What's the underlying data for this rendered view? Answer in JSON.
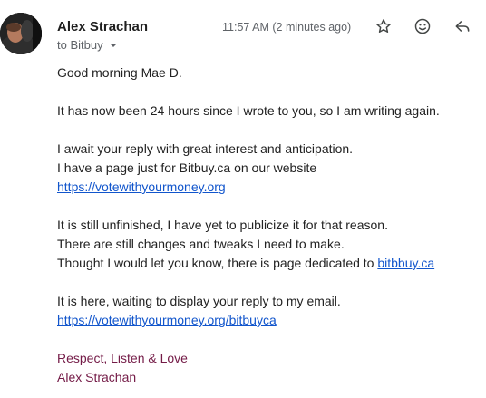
{
  "sender": {
    "name": "Alex Strachan",
    "recipient_label": "to Bitbuy"
  },
  "header": {
    "timestamp": "11:57 AM (2 minutes ago)",
    "actions": [
      "star-icon",
      "emoji-icon",
      "reply-icon"
    ]
  },
  "message": {
    "greeting": "Good morning Mae D.",
    "para1": "It has now been 24 hours since I wrote to you, so I am writing again.",
    "para2_line1": "I await your reply with great interest and anticipation.",
    "para2_line2": "I have a page just for Bitbuy.ca on our website",
    "link1": "https://votewithyourmoney.org",
    "para3_line1": "It is still unfinished, I have yet to publicize it for that reason.",
    "para3_line2": "There are still changes and tweaks I need to make.",
    "para3_line3_prefix": "Thought I would let you know, there is page dedicated to ",
    "link2": "bitbbuy.ca",
    "para4_line1": "It is here, waiting to display your reply to my email.",
    "link3": "https://votewithyourmoney.org/bitbuyca",
    "signoff": "Respect, Listen & Love",
    "signature_name": "Alex Strachan"
  },
  "colors": {
    "link": "#1155cc",
    "signature": "#741b47",
    "meta_text": "#5f6368"
  }
}
